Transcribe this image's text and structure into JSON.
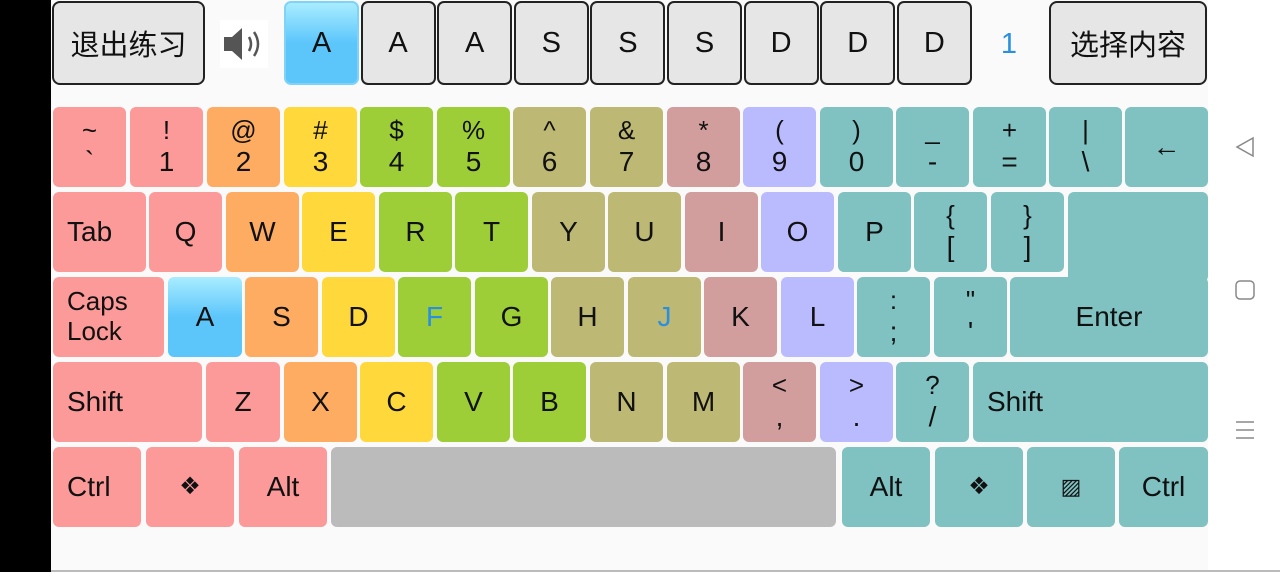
{
  "topbar": {
    "exit_label": "退出练习",
    "select_label": "选择内容",
    "speaker_icon": "speaker-volume-icon",
    "targets": [
      "A",
      "A",
      "A",
      "S",
      "S",
      "S",
      "D",
      "D",
      "D"
    ],
    "current_index": 0,
    "counter": "1"
  },
  "colors": {
    "pink": "#fc9a9a",
    "orange": "#fdac62",
    "yellow": "#ffd83c",
    "green": "#9dcd37",
    "olive": "#bdb874",
    "rose": "#d29d9d",
    "lavender": "#babaff",
    "teal": "#80c1c1",
    "space": "#bbbbbb",
    "highlight": "#5cc6fb",
    "marker_text": "#2a8fe0",
    "counter_text": "#2a8fe0"
  },
  "keyboard": {
    "rows": [
      [
        {
          "t": "~",
          "b": "`",
          "c": "pink"
        },
        {
          "t": "!",
          "b": "1",
          "c": "pink"
        },
        {
          "t": "@",
          "b": "2",
          "c": "orange"
        },
        {
          "t": "#",
          "b": "3",
          "c": "yellow"
        },
        {
          "t": "$",
          "b": "4",
          "c": "green"
        },
        {
          "t": "%",
          "b": "5",
          "c": "green"
        },
        {
          "t": "^",
          "b": "6",
          "c": "olive"
        },
        {
          "t": "&",
          "b": "7",
          "c": "olive"
        },
        {
          "t": "*",
          "b": "8",
          "c": "rose"
        },
        {
          "t": "(",
          "b": "9",
          "c": "lavender"
        },
        {
          "t": ")",
          "b": "0",
          "c": "teal"
        },
        {
          "t": "_",
          "b": "-",
          "c": "teal"
        },
        {
          "t": "+",
          "b": "=",
          "c": "teal"
        },
        {
          "t": "|",
          "b": "\\",
          "c": "teal"
        },
        {
          "l": "←",
          "c": "teal",
          "name": "backspace"
        }
      ],
      [
        {
          "l": "Tab",
          "c": "pink",
          "left": true
        },
        {
          "l": "Q",
          "c": "pink"
        },
        {
          "l": "W",
          "c": "orange"
        },
        {
          "l": "E",
          "c": "yellow"
        },
        {
          "l": "R",
          "c": "green"
        },
        {
          "l": "T",
          "c": "green"
        },
        {
          "l": "Y",
          "c": "olive"
        },
        {
          "l": "U",
          "c": "olive"
        },
        {
          "l": "I",
          "c": "rose"
        },
        {
          "l": "O",
          "c": "lavender"
        },
        {
          "l": "P",
          "c": "teal"
        },
        {
          "t": "{",
          "b": "[",
          "c": "teal"
        },
        {
          "t": "}",
          "b": "]",
          "c": "teal"
        }
      ],
      [
        {
          "t": "Caps",
          "b": "Lock",
          "c": "pink",
          "left": true,
          "name": "caps-lock"
        },
        {
          "l": "A",
          "c": "pink",
          "active": true
        },
        {
          "l": "S",
          "c": "orange"
        },
        {
          "l": "D",
          "c": "yellow"
        },
        {
          "l": "F",
          "c": "green",
          "marker": true
        },
        {
          "l": "G",
          "c": "green"
        },
        {
          "l": "H",
          "c": "olive"
        },
        {
          "l": "J",
          "c": "olive",
          "marker": true
        },
        {
          "l": "K",
          "c": "rose"
        },
        {
          "l": "L",
          "c": "lavender"
        },
        {
          "t": ":",
          "b": ";",
          "c": "teal"
        },
        {
          "t": "\"",
          "b": "'",
          "c": "teal"
        },
        {
          "l": "Enter",
          "c": "teal",
          "name": "enter"
        }
      ],
      [
        {
          "l": "Shift",
          "c": "pink",
          "left": true,
          "name": "left-shift"
        },
        {
          "l": "Z",
          "c": "pink"
        },
        {
          "l": "X",
          "c": "orange"
        },
        {
          "l": "C",
          "c": "yellow"
        },
        {
          "l": "V",
          "c": "green"
        },
        {
          "l": "B",
          "c": "green"
        },
        {
          "l": "N",
          "c": "olive"
        },
        {
          "l": "M",
          "c": "olive"
        },
        {
          "t": "<",
          "b": ",",
          "c": "rose"
        },
        {
          "t": ">",
          "b": ".",
          "c": "lavender"
        },
        {
          "t": "?",
          "b": "/",
          "c": "teal"
        },
        {
          "l": "Shift",
          "c": "teal",
          "left": true,
          "name": "right-shift"
        }
      ],
      [
        {
          "l": "Ctrl",
          "c": "pink",
          "left": true,
          "name": "left-ctrl"
        },
        {
          "l": "❖",
          "c": "pink",
          "name": "left-win"
        },
        {
          "l": "Alt",
          "c": "pink",
          "name": "left-alt"
        },
        {
          "l": "",
          "c": "space",
          "name": "space"
        },
        {
          "l": "Alt",
          "c": "teal",
          "name": "right-alt"
        },
        {
          "l": "❖",
          "c": "teal",
          "name": "right-win"
        },
        {
          "l": "▨",
          "c": "teal",
          "name": "menu"
        },
        {
          "l": "Ctrl",
          "c": "teal",
          "name": "right-ctrl"
        }
      ]
    ]
  },
  "navbar": {
    "back_icon": "back-triangle-icon",
    "home_icon": "home-square-icon",
    "menu_icon": "menu-lines-icon"
  }
}
